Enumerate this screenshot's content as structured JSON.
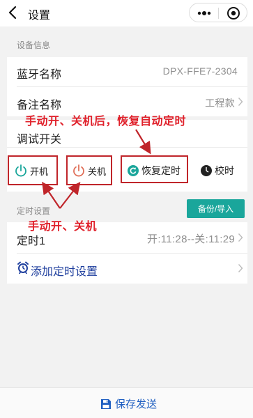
{
  "nav": {
    "title": "设置"
  },
  "device_info": {
    "section_label": "设备信息",
    "bluetooth_name_label": "蓝牙名称",
    "bluetooth_name_value": "DPX-FFE7-2304",
    "remark_name_label": "备注名称",
    "remark_name_value": "工程款"
  },
  "debug": {
    "title": "调试开关",
    "buttons": [
      {
        "label": "开机",
        "icon": "power-icon",
        "color": "#1aa69b"
      },
      {
        "label": "关机",
        "icon": "power-icon",
        "color": "#e0705a"
      },
      {
        "label": "恢复定时",
        "icon": "refresh-icon",
        "color": "#1aa69b"
      },
      {
        "label": "校时",
        "icon": "clock-icon",
        "color": "#222222"
      }
    ]
  },
  "timer": {
    "section_label": "定时设置",
    "backup_label": "备份/导入",
    "items": [
      {
        "label": "定时1",
        "value": "开:11:28--关:11:29"
      }
    ],
    "add_label": "添加定时设置"
  },
  "annotations": {
    "top": "手动开、关机后，恢复自动定时",
    "bottom": "手动开、关机"
  },
  "footer": {
    "save_label": "保存发送"
  },
  "colors": {
    "accent": "#1aa69b",
    "annotation_red": "#e0212b",
    "save_blue": "#1f5fc1"
  }
}
